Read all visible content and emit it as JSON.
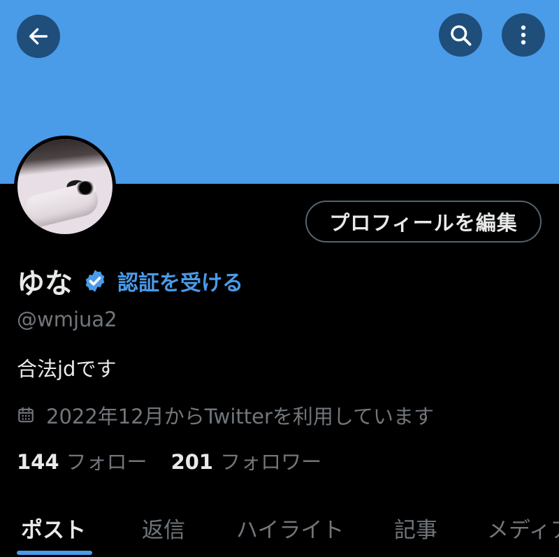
{
  "header": {
    "back_icon": "arrow-left-icon",
    "search_icon": "search-icon",
    "more_icon": "more-vertical-icon",
    "banner_color": "#4a9be8"
  },
  "profile": {
    "edit_label": "プロフィールを編集",
    "name": "ゆな",
    "verify_icon": "verified-badge-icon",
    "verify_link": "認証を受ける",
    "handle": "@wmjua2",
    "bio": "合法jdです",
    "joined_icon": "calendar-icon",
    "joined": "2022年12月からTwitterを利用しています",
    "following_count": "144",
    "following_label": "フォロー",
    "followers_count": "201",
    "followers_label": "フォロワー"
  },
  "tabs": [
    {
      "label": "ポスト",
      "active": true
    },
    {
      "label": "返信",
      "active": false
    },
    {
      "label": "ハイライト",
      "active": false
    },
    {
      "label": "記事",
      "active": false
    },
    {
      "label": "メディア",
      "active": false
    }
  ],
  "colors": {
    "accent": "#4a9be8",
    "background": "#000000",
    "text_primary": "#e7e9ea",
    "text_secondary": "#71767b"
  }
}
